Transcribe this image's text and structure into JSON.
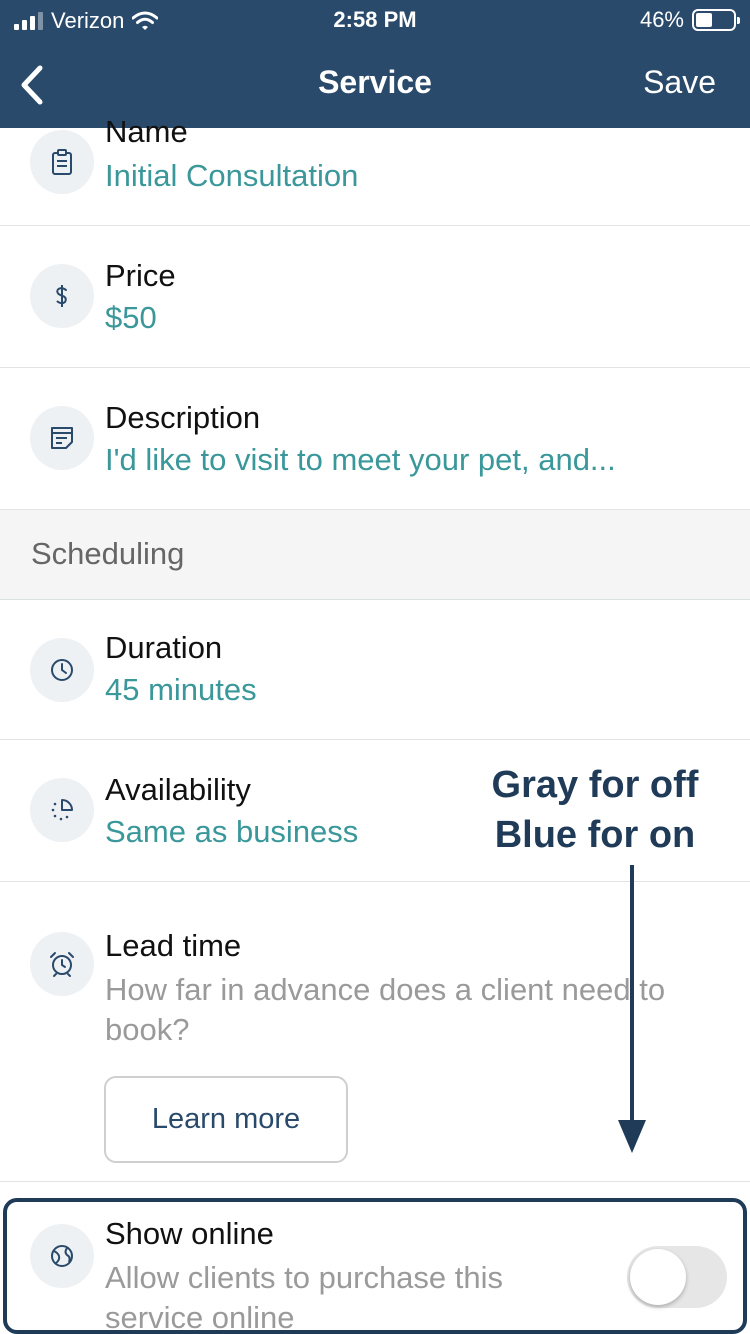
{
  "status_bar": {
    "carrier": "Verizon",
    "time": "2:58 PM",
    "battery_percent": "46%",
    "battery_level": 0.46
  },
  "nav": {
    "title": "Service",
    "save_label": "Save",
    "back_icon": "chevron-left-icon"
  },
  "fields": {
    "name": {
      "label": "Name",
      "value": "Initial Consultation",
      "icon": "clipboard-icon"
    },
    "price": {
      "label": "Price",
      "value": "$50",
      "icon": "dollar-icon"
    },
    "description": {
      "label": "Description",
      "value": "I'd like to visit to meet your pet, and...",
      "icon": "notes-icon"
    }
  },
  "scheduling": {
    "header": "Scheduling",
    "duration": {
      "label": "Duration",
      "value": "45 minutes",
      "icon": "clock-icon"
    },
    "availability": {
      "label": "Availability",
      "value": "Same as business",
      "icon": "availability-icon"
    },
    "lead_time": {
      "label": "Lead time",
      "description": "How far in advance does a client need to book?",
      "button_label": "Learn more",
      "icon": "alarm-icon"
    },
    "show_online": {
      "label": "Show online",
      "description": "Allow clients to purchase this service online",
      "enabled": false,
      "icon": "globe-icon"
    }
  },
  "annotation": {
    "line1": "Gray for off",
    "line2": "Blue for on"
  },
  "colors": {
    "nav_background": "#2a4a6b",
    "value_text": "#3a979a",
    "annotation": "#1f3b58",
    "toggle_off": "#e6e6e6"
  }
}
